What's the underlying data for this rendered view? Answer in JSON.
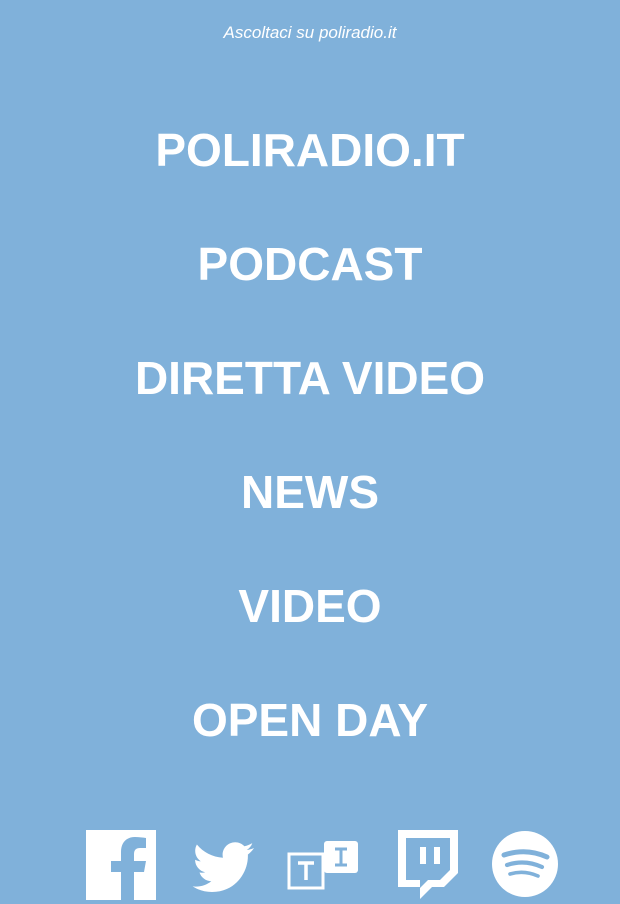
{
  "header": {
    "tagline": "Ascoltaci su poliradio.it"
  },
  "menu": {
    "items": [
      {
        "label": "POLIRADIO.IT"
      },
      {
        "label": "PODCAST"
      },
      {
        "label": "DIRETTA VIDEO"
      },
      {
        "label": "NEWS"
      },
      {
        "label": "VIDEO"
      },
      {
        "label": "OPEN DAY"
      }
    ]
  },
  "socials": [
    {
      "icon": "facebook-icon"
    },
    {
      "icon": "twitter-icon"
    },
    {
      "icon": "teams-icon"
    },
    {
      "icon": "twitch-icon"
    },
    {
      "icon": "spotify-icon"
    }
  ],
  "colors": {
    "background": "#80b1da",
    "foreground": "#ffffff"
  }
}
